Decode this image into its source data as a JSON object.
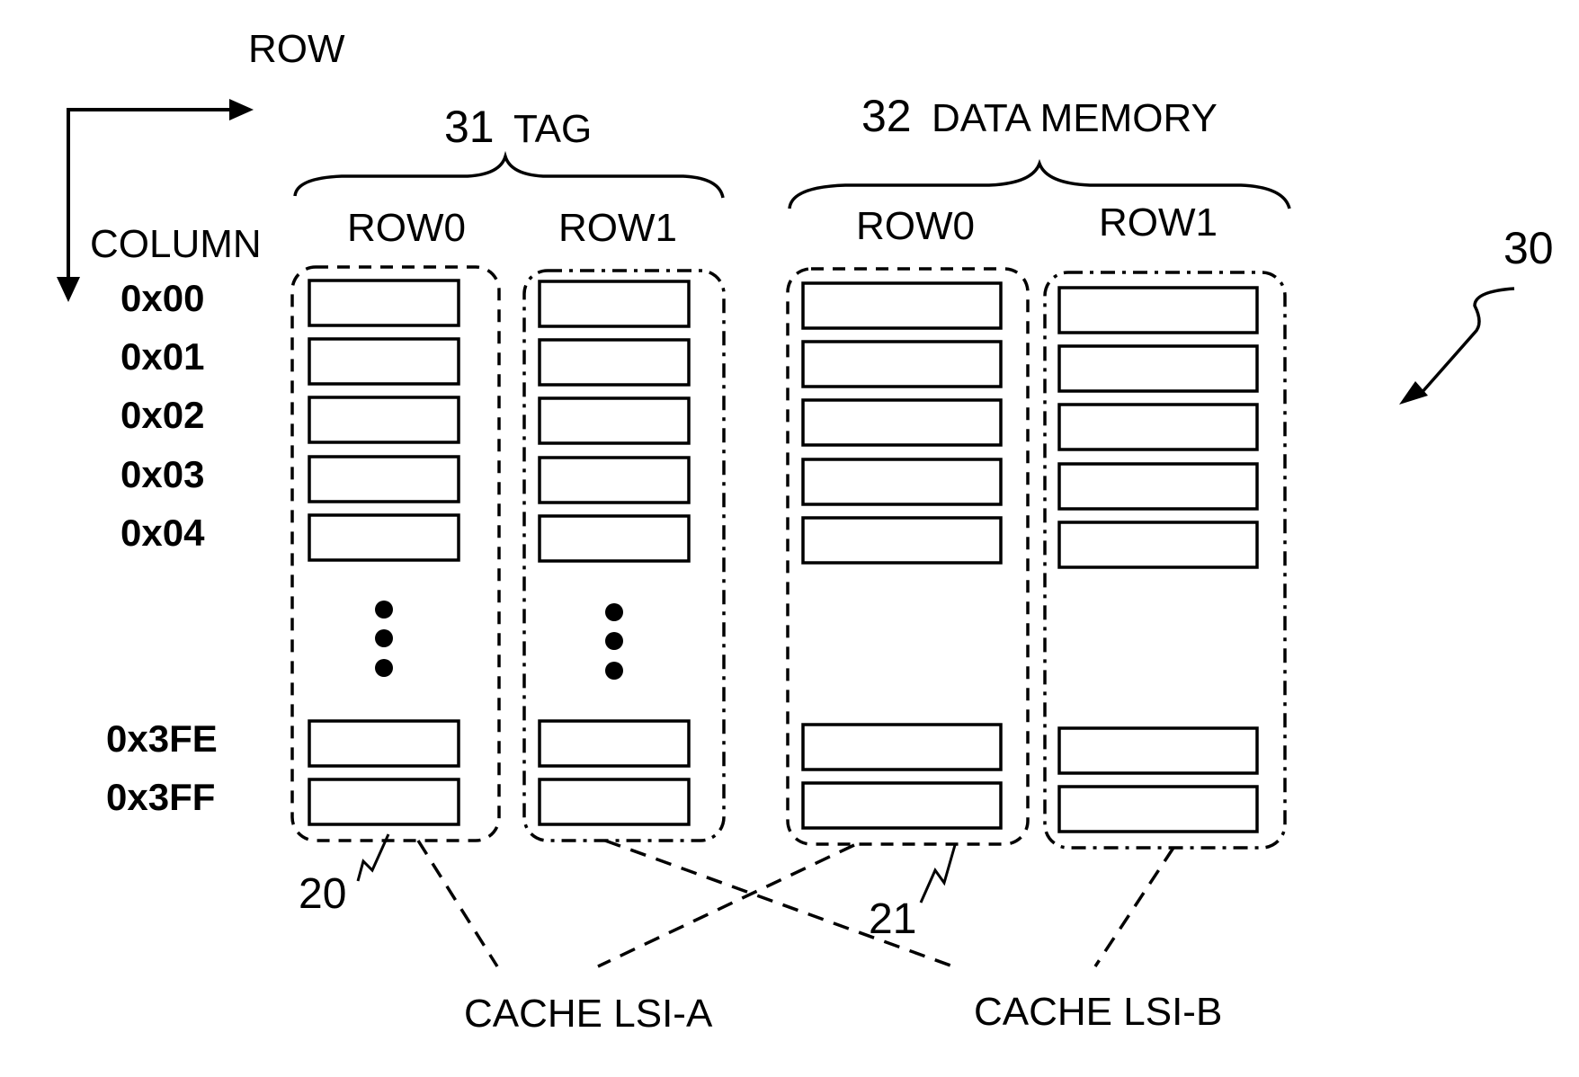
{
  "figure": {
    "reference_numeral": "30",
    "axis": {
      "row_label": "ROW",
      "column_label": "COLUMN"
    },
    "column_addresses": [
      "0x00",
      "0x01",
      "0x02",
      "0x03",
      "0x04",
      "0x3FE",
      "0x3FF"
    ],
    "ellipsis": "⋮",
    "groups": [
      {
        "id": "tag",
        "numeral": "31",
        "title": "TAG",
        "rows": [
          {
            "label": "ROW0",
            "border": "dashed",
            "ellipsis": true
          },
          {
            "label": "ROW1",
            "border": "dash-dot",
            "ellipsis": true
          }
        ]
      },
      {
        "id": "data-memory",
        "numeral": "32",
        "title": "DATA MEMORY",
        "rows": [
          {
            "label": "ROW0",
            "border": "dashed",
            "ellipsis": false
          },
          {
            "label": "ROW1",
            "border": "dash-dot",
            "ellipsis": false
          }
        ]
      }
    ],
    "callouts": [
      {
        "numeral": "20",
        "target": "Tag ROW0 region"
      },
      {
        "numeral": "21",
        "target": "Data Memory ROW0 region"
      }
    ],
    "caches": [
      {
        "label": "CACHE LSI-A",
        "connects": [
          "Tag ROW0",
          "Data Memory ROW0"
        ]
      },
      {
        "label": "CACHE LSI-B",
        "connects": [
          "Tag ROW1",
          "Data Memory ROW1"
        ]
      }
    ]
  }
}
